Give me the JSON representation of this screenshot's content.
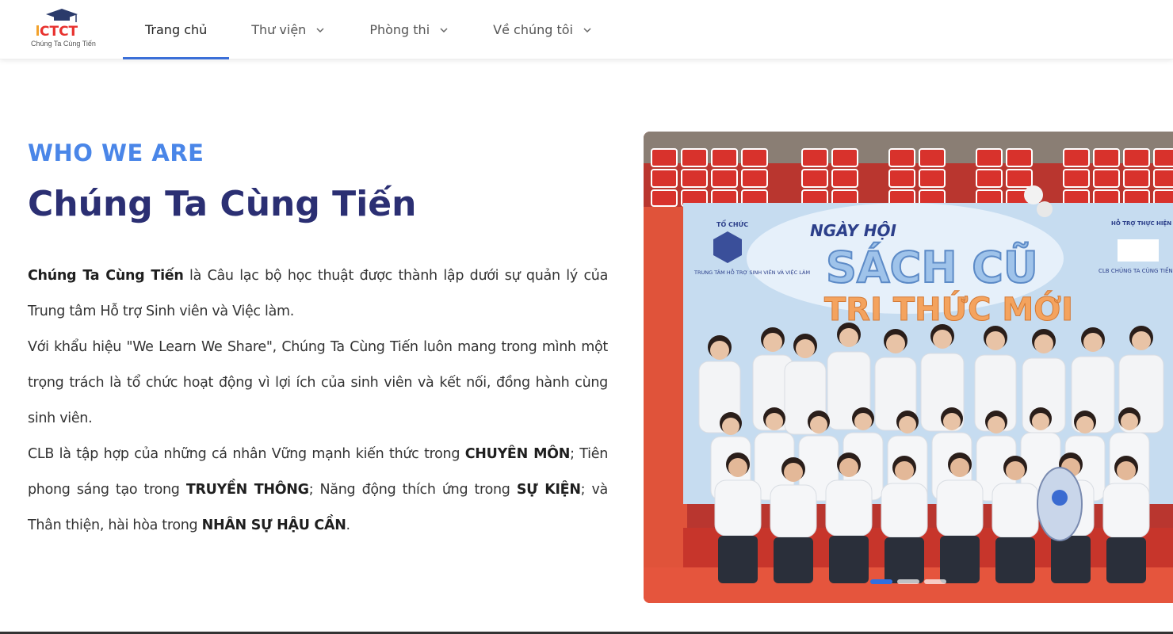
{
  "brand": {
    "logo_text": "CTCT",
    "tagline": "Chúng Ta Cùng Tiến",
    "colors": {
      "accent": "#3b6fd8",
      "eyebrow": "#4a86e8",
      "title": "#2b2f73"
    }
  },
  "nav": {
    "items": [
      {
        "label": "Trang chủ",
        "dropdown": false,
        "active": true
      },
      {
        "label": "Thư viện",
        "dropdown": true,
        "active": false
      },
      {
        "label": "Phòng thi",
        "dropdown": true,
        "active": false
      },
      {
        "label": "Về chúng tôi",
        "dropdown": true,
        "active": false
      }
    ]
  },
  "about": {
    "eyebrow": "WHO WE ARE",
    "title": "Chúng Ta Cùng Tiến",
    "p1_bold": "Chúng Ta Cùng Tiến",
    "p1_rest": " là Câu lạc bộ học thuật được thành lập dưới sự quản lý của Trung tâm Hỗ trợ Sinh viên và Việc làm.",
    "p2": "Với khẩu hiệu \"We Learn We Share\", Chúng Ta Cùng Tiến luôn mang trong mình một trọng trách là tổ chức hoạt động vì lợi ích của sinh viên và kết nối, đồng hành cùng sinh viên.",
    "p3_a": "CLB là tập hợp của những cá nhân Vững mạnh kiến thức trong ",
    "p3_b1": "CHUYÊN MÔN",
    "p3_c": "; Tiên phong sáng tạo trong ",
    "p3_b2": "TRUYỀN THÔNG",
    "p3_d": "; Năng động thích ứng trong ",
    "p3_b3": "SỰ KIỆN",
    "p3_e": "; và Thân thiện, hài hòa trong ",
    "p3_b4": "NHÂN SỰ HẬU CẦN",
    "p3_f": "."
  },
  "photo": {
    "banner_top": "NGÀY HỘI",
    "banner_main": "SÁCH CŨ",
    "banner_sub": "TRI THỨC MỚI",
    "left_org_label": "TỔ CHỨC",
    "left_org_name": "TRUNG TÂM HỖ TRỢ SINH VIÊN VÀ VIỆC LÀM",
    "right_org_label": "HỖ TRỢ THỰC HIỆN",
    "right_org_name": "CLB CHÚNG TA CÙNG TIẾN",
    "carousel_count": 3,
    "carousel_active": 0
  }
}
